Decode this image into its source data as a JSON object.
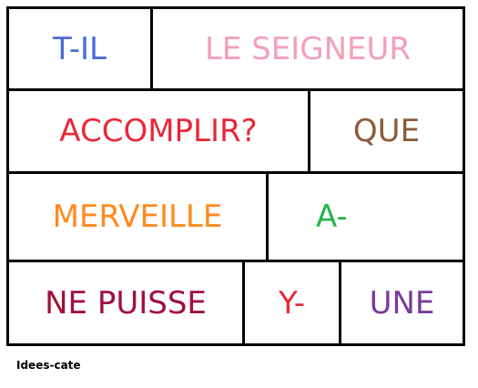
{
  "rows": [
    [
      {
        "text": "T-IL",
        "color": "#4a6bd6"
      },
      {
        "text": "LE SEIGNEUR",
        "color": "#f2a0b6"
      }
    ],
    [
      {
        "text": "ACCOMPLIR?",
        "color": "#e8283a"
      },
      {
        "text": "QUE",
        "color": "#8b5a3c"
      }
    ],
    [
      {
        "text": "MERVEILLE",
        "color": "#ff8a1f"
      },
      {
        "text": "A-",
        "color": "#24b34a"
      }
    ],
    [
      {
        "text": "NE PUISSE",
        "color": "#a0103a"
      },
      {
        "text": "Y-",
        "color": "#e8283a"
      },
      {
        "text": "UNE",
        "color": "#7a3b9a"
      }
    ]
  ],
  "footer": "Idees-cate"
}
